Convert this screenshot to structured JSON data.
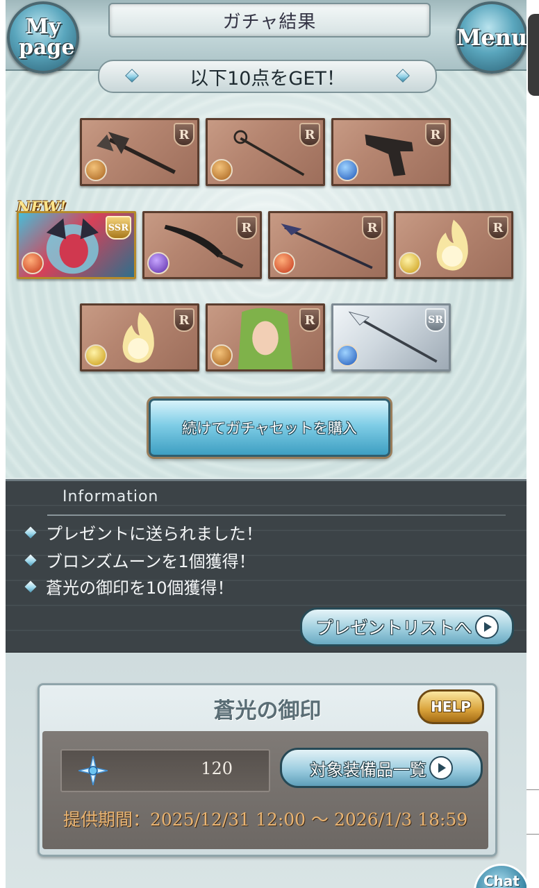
{
  "header": {
    "title": "ガチャ結果",
    "mypage_label": "My page",
    "menu_label": "Menu"
  },
  "result": {
    "get_label": "以下10点をGET！",
    "new_label": "NEW!",
    "items": [
      {
        "rarity": "R",
        "element": "earth",
        "icon": "battle-axe-icon"
      },
      {
        "rarity": "R",
        "element": "earth",
        "icon": "staff-icon"
      },
      {
        "rarity": "R",
        "element": "water",
        "icon": "revolver-icon"
      },
      {
        "rarity": "SSR",
        "element": "fire",
        "icon": "character-portrait-icon"
      },
      {
        "rarity": "R",
        "element": "dark",
        "icon": "sword-icon"
      },
      {
        "rarity": "R",
        "element": "fire",
        "icon": "spear-icon"
      },
      {
        "rarity": "R",
        "element": "light",
        "icon": "flame-spirit-icon"
      },
      {
        "rarity": "R",
        "element": "light",
        "icon": "flame-spirit-icon"
      },
      {
        "rarity": "R",
        "element": "earth",
        "icon": "character-portrait-icon"
      },
      {
        "rarity": "SR",
        "element": "water",
        "icon": "lance-icon"
      }
    ],
    "continue_label": "続けてガチャセットを購入"
  },
  "info": {
    "title": "Information",
    "messages": [
      "プレゼントに送られました！",
      "ブロンズムーンを1個獲得！",
      "蒼光の御印を10個獲得！"
    ],
    "present_list_label": "プレゼントリストへ"
  },
  "seal": {
    "title": "蒼光の御印",
    "help_label": "HELP",
    "count": "120",
    "equip_list_label": "対象装備品一覧",
    "period": "提供期間：2025/12/31 12:00 〜 2026/1/3 18:59"
  },
  "chat_label": "Chat"
}
